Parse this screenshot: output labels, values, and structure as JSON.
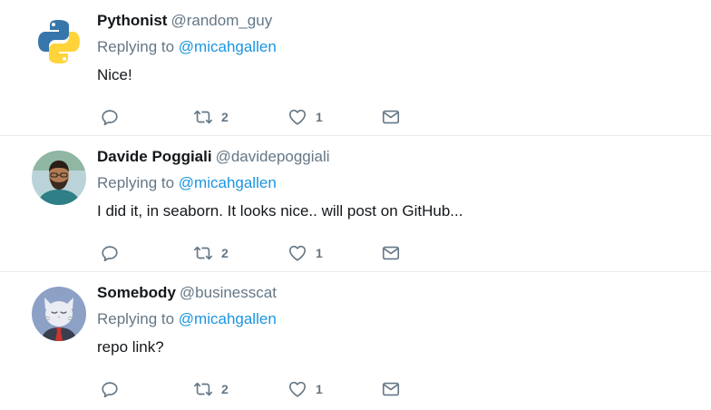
{
  "tweets": [
    {
      "name": "Pythonist",
      "handle": "@random_guy",
      "replying_prefix": "Replying to",
      "replying_to": "@micahgallen",
      "text": "Nice!",
      "retweets": "2",
      "likes": "1",
      "avatar": "python-logo-avatar"
    },
    {
      "name": "Davide Poggiali",
      "handle": "@davidepoggiali",
      "replying_prefix": "Replying to",
      "replying_to": "@micahgallen",
      "text": "I did it, in seaborn. It looks nice.. will post on GitHub...",
      "retweets": "2",
      "likes": "1",
      "avatar": "person-photo-avatar"
    },
    {
      "name": "Somebody",
      "handle": "@businesscat",
      "replying_prefix": "Replying to",
      "replying_to": "@micahgallen",
      "text": "repo link?",
      "retweets": "2",
      "likes": "1",
      "avatar": "business-cat-avatar"
    }
  ],
  "icons": {
    "reply": "reply-icon",
    "retweet": "retweet-icon",
    "like": "heart-icon",
    "dm": "envelope-icon"
  },
  "colors": {
    "name": "#14171a",
    "secondary": "#657786",
    "mention": "#1b95e0",
    "divider": "#e6ecf0"
  }
}
